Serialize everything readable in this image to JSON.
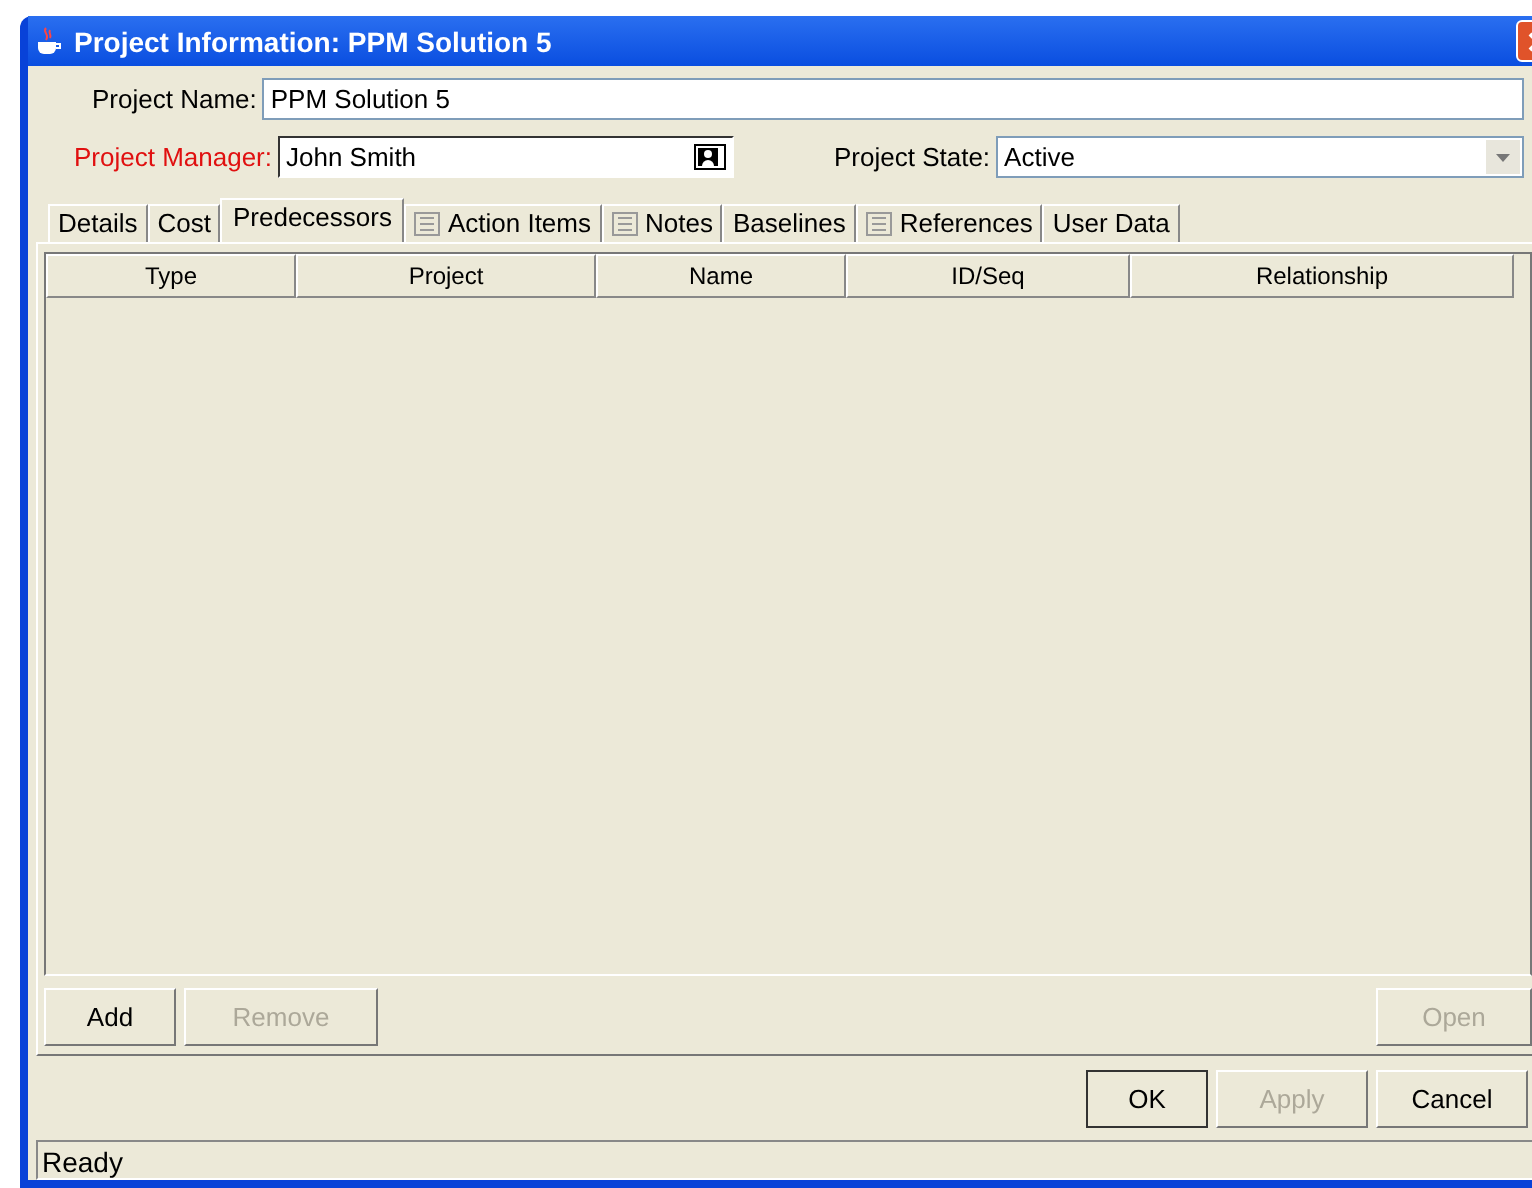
{
  "window": {
    "title": "Project Information: PPM Solution 5"
  },
  "fields": {
    "project_name": {
      "label": "Project Name:",
      "value": "PPM Solution 5"
    },
    "project_manager": {
      "label": "Project Manager:",
      "value": "John Smith",
      "required": true
    },
    "project_state": {
      "label": "Project State:",
      "value": "Active"
    }
  },
  "tabs": [
    {
      "label": "Details",
      "selected": false,
      "icon": false
    },
    {
      "label": "Cost",
      "selected": false,
      "icon": false
    },
    {
      "label": "Predecessors",
      "selected": true,
      "icon": false
    },
    {
      "label": "Action Items",
      "selected": false,
      "icon": true
    },
    {
      "label": "Notes",
      "selected": false,
      "icon": true
    },
    {
      "label": "Baselines",
      "selected": false,
      "icon": false
    },
    {
      "label": "References",
      "selected": false,
      "icon": true
    },
    {
      "label": "User Data",
      "selected": false,
      "icon": false
    }
  ],
  "table": {
    "columns": [
      "Type",
      "Project",
      "Name",
      "ID/Seq",
      "Relationship"
    ]
  },
  "panel_buttons": [
    {
      "label": "Add",
      "disabled": false
    },
    {
      "label": "Remove",
      "disabled": true
    },
    {
      "label": "Open",
      "disabled": true
    }
  ],
  "dialog_buttons": [
    {
      "label": "OK",
      "disabled": false
    },
    {
      "label": "Apply",
      "disabled": true
    },
    {
      "label": "Cancel",
      "disabled": false
    }
  ],
  "status_bar": "Ready"
}
